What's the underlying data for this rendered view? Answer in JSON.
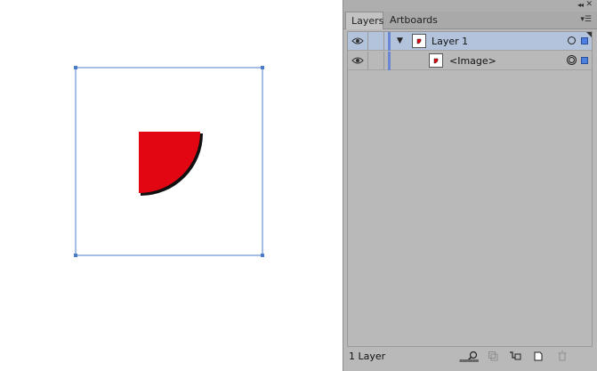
{
  "panel": {
    "tabs": [
      "Layers",
      "Artboards"
    ],
    "layers": [
      {
        "name": "Layer 1",
        "expanded": true,
        "selected": true,
        "color": "#6b87d4"
      },
      {
        "name": "<Image>",
        "selected": false
      }
    ],
    "footer": {
      "layer_count": "1 Layer"
    },
    "toolbar_icons": [
      "locate-object-icon",
      "make-clipping-mask-icon",
      "create-sublayer-icon",
      "create-new-layer-icon",
      "delete-icon"
    ]
  },
  "artwork": {
    "shape_color": "#e20612",
    "selection_color": "#4a7cc9"
  }
}
